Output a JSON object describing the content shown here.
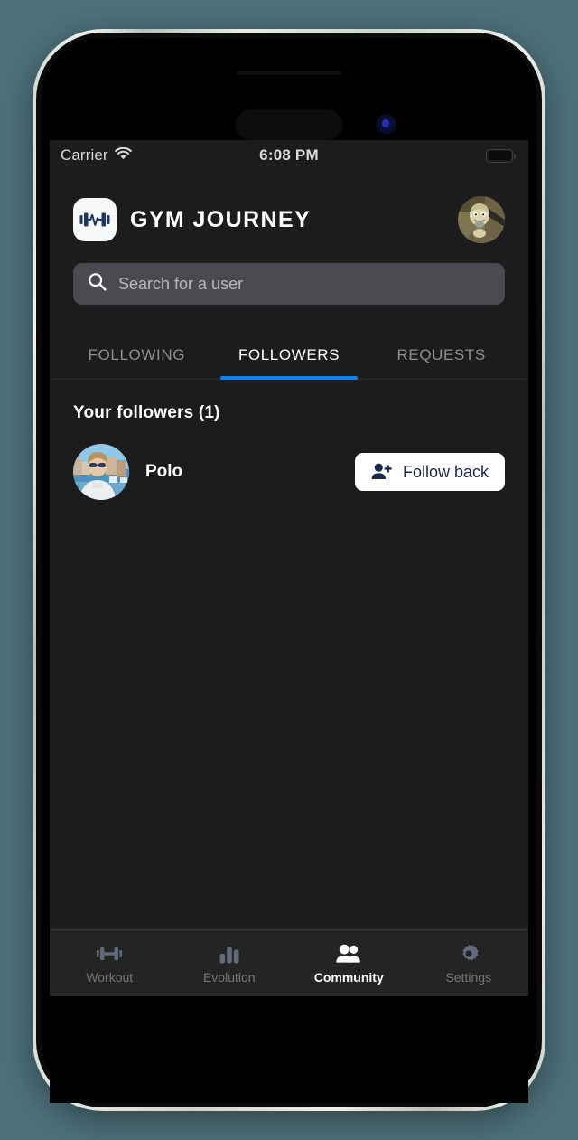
{
  "status_bar": {
    "carrier": "Carrier",
    "wifi_icon": "wifi-icon",
    "time": "6:08 PM",
    "battery_icon": "battery-full-icon"
  },
  "header": {
    "logo_icon": "dumbbell-pulse-logo-icon",
    "title": "GYM JOURNEY",
    "avatar_name": "profile-avatar"
  },
  "search": {
    "icon": "search-icon",
    "placeholder": "Search for a user",
    "value": ""
  },
  "tabs": [
    {
      "label": "FOLLOWING",
      "active": false
    },
    {
      "label": "FOLLOWERS",
      "active": true
    },
    {
      "label": "REQUESTS",
      "active": false
    }
  ],
  "list": {
    "heading": "Your followers (1)",
    "count": 1,
    "users": [
      {
        "name": "Polo",
        "avatar": "user-avatar-polo",
        "action_label": "Follow back",
        "action_icon": "person-add-icon"
      }
    ]
  },
  "bottom_nav": [
    {
      "label": "Workout",
      "icon": "dumbbell-icon",
      "active": false
    },
    {
      "label": "Evolution",
      "icon": "bar-chart-icon",
      "active": false
    },
    {
      "label": "Community",
      "icon": "people-icon",
      "active": true
    },
    {
      "label": "Settings",
      "icon": "gear-icon",
      "active": false
    }
  ],
  "colors": {
    "accent_blue": "#0b84f3",
    "logo_navy": "#1f3566",
    "app_background": "#1c1c1c",
    "nav_background": "#242424",
    "page_background": "#4d707a",
    "button_text_navy": "#1b2a4e"
  }
}
